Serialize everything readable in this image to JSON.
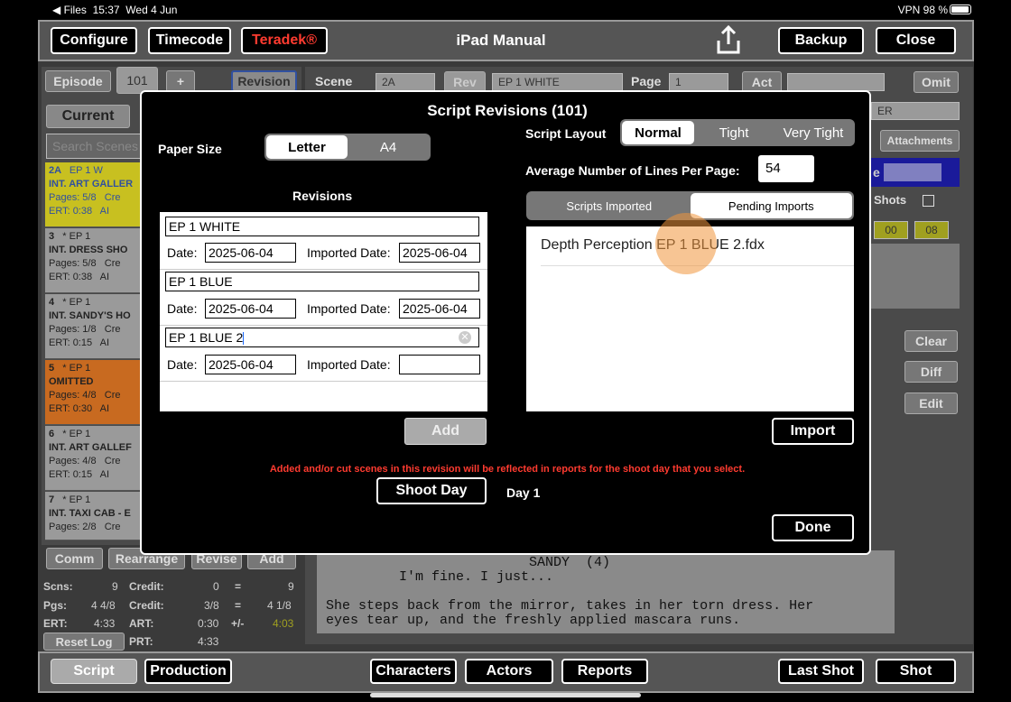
{
  "status_bar": {
    "back_app": "◀ Files",
    "time": "15:37",
    "date": "Wed 4 Jun",
    "right": "VPN  98 %"
  },
  "top_bar": {
    "configure": "Configure",
    "timecode": "Timecode",
    "teradek": "Teradek®",
    "title": "iPad Manual",
    "backup": "Backup",
    "close": "Close",
    "teradek_color": "#ff3b30"
  },
  "bottom_bar": {
    "script": "Script",
    "production": "Production",
    "characters": "Characters",
    "actors": "Actors",
    "reports": "Reports",
    "last_shot": "Last Shot",
    "shot": "Shot"
  },
  "background": {
    "episode_btn": "Episode",
    "episode_value": "101",
    "plus": "+",
    "revision_btn": "Revision",
    "scene_lbl": "Scene",
    "scene_value": "2A",
    "rev_btn": "Rev",
    "rev_value": "EP 1 WHITE",
    "page_lbl": "Page",
    "page_value": "1",
    "act_btn": "Act",
    "omit_btn": "Omit",
    "current_tab": "Current",
    "search_placeholder": "Search Scenes",
    "attachments": "Attachments",
    "shots_lbl": "Shots",
    "tc_a": "00",
    "tc_b": "08",
    "partial_e": "e",
    "partial_er": "ER",
    "clear": "Clear",
    "diff": "Diff",
    "edit": "Edit",
    "comm": "Comm",
    "rearrange": "Rearrange",
    "revise": "Revise",
    "add": "Add",
    "reset_log": "Reset Log",
    "scenes": [
      {
        "num": "2A",
        "rev": "EP 1 W",
        "heading": "INT. ART GALLER",
        "pages": "Pages: 5/8",
        "cre": "Cre",
        "ert": "ERT:  0:38",
        "ar": "AI",
        "color": "#c8c020"
      },
      {
        "num": "3",
        "rev": "* EP 1",
        "heading": "INT. DRESS SHO",
        "pages": "Pages: 5/8",
        "cre": "Cre",
        "ert": "ERT:  0:38",
        "ar": "AI",
        "color": "#9a9a9a"
      },
      {
        "num": "4",
        "rev": "* EP 1",
        "heading": "INT. SANDY'S HO",
        "pages": "Pages: 1/8",
        "cre": "Cre",
        "ert": "ERT:  0:15",
        "ar": "AI",
        "color": "#9a9a9a"
      },
      {
        "num": "5",
        "rev": "* EP 1",
        "heading": "OMITTED",
        "pages": "Pages: 4/8",
        "cre": "Cre",
        "ert": "ERT:  0:30",
        "ar": "AI",
        "color": "#c86a20"
      },
      {
        "num": "6",
        "rev": "* EP 1",
        "heading": "INT. ART GALLEF",
        "pages": "Pages: 4/8",
        "cre": "Cre",
        "ert": "ERT:  0:15",
        "ar": "AI",
        "color": "#9a9a9a"
      },
      {
        "num": "7",
        "rev": "* EP 1",
        "heading": "INT. TAXI CAB - E",
        "pages": "Pages: 2/8",
        "cre": "Cre",
        "ert": "",
        "ar": "",
        "color": "#9a9a9a"
      }
    ],
    "stats": {
      "scns_lbl": "Scns:",
      "scns": "9",
      "credit_lbl": "Credit:",
      "credit": "0",
      "eq": "=",
      "credit_total": "9",
      "pgs_lbl": "Pgs:",
      "pgs": "4 4/8",
      "credit2_lbl": "Credit:",
      "credit2": "3/8",
      "eq2": "=",
      "pgs_total": "4 1/8",
      "ert_lbl": "ERT:",
      "ert": "4:33",
      "art_lbl": "ART:",
      "art": "0:30",
      "pm": "+/-",
      "diff": "4:03",
      "prt_lbl": "PRT:",
      "prt": "4:33"
    },
    "script_text": "                         SANDY  (4)\n         I'm fine. I just...\n\nShe steps back from the mirror, takes in her torn dress. Her\neyes tear up, and the freshly applied mascara runs."
  },
  "modal": {
    "title": "Script Revisions (101)",
    "paper_size_lbl": "Paper Size",
    "paper_options": [
      "Letter",
      "A4"
    ],
    "paper_selected": "Letter",
    "script_layout_lbl": "Script Layout",
    "layout_options": [
      "Normal",
      "Tight",
      "Very Tight"
    ],
    "layout_selected": "Normal",
    "avg_lines_lbl": "Average Number of Lines Per Page:",
    "avg_lines_value": "54",
    "revisions_lbl": "Revisions",
    "date_lbl": "Date:",
    "imported_lbl": "Imported Date:",
    "revisions": [
      {
        "name": "EP 1 WHITE",
        "date": "2025-06-04",
        "imported": "2025-06-04"
      },
      {
        "name": "EP 1 BLUE",
        "date": "2025-06-04",
        "imported": "2025-06-04"
      },
      {
        "name": "EP 1 BLUE 2",
        "date": "2025-06-04",
        "imported": ""
      }
    ],
    "add_btn": "Add",
    "import_tabs": [
      "Scripts Imported",
      "Pending Imports"
    ],
    "import_tab_selected": "Pending Imports",
    "pending_imports": [
      "Depth Perception EP 1 BLUE 2.fdx"
    ],
    "import_btn": "Import",
    "warning": "Added and/or cut scenes in this revision will be reflected in reports for the shoot day that you select.",
    "shoot_day_btn": "Shoot Day",
    "shoot_day_value": "Day 1",
    "done_btn": "Done"
  }
}
